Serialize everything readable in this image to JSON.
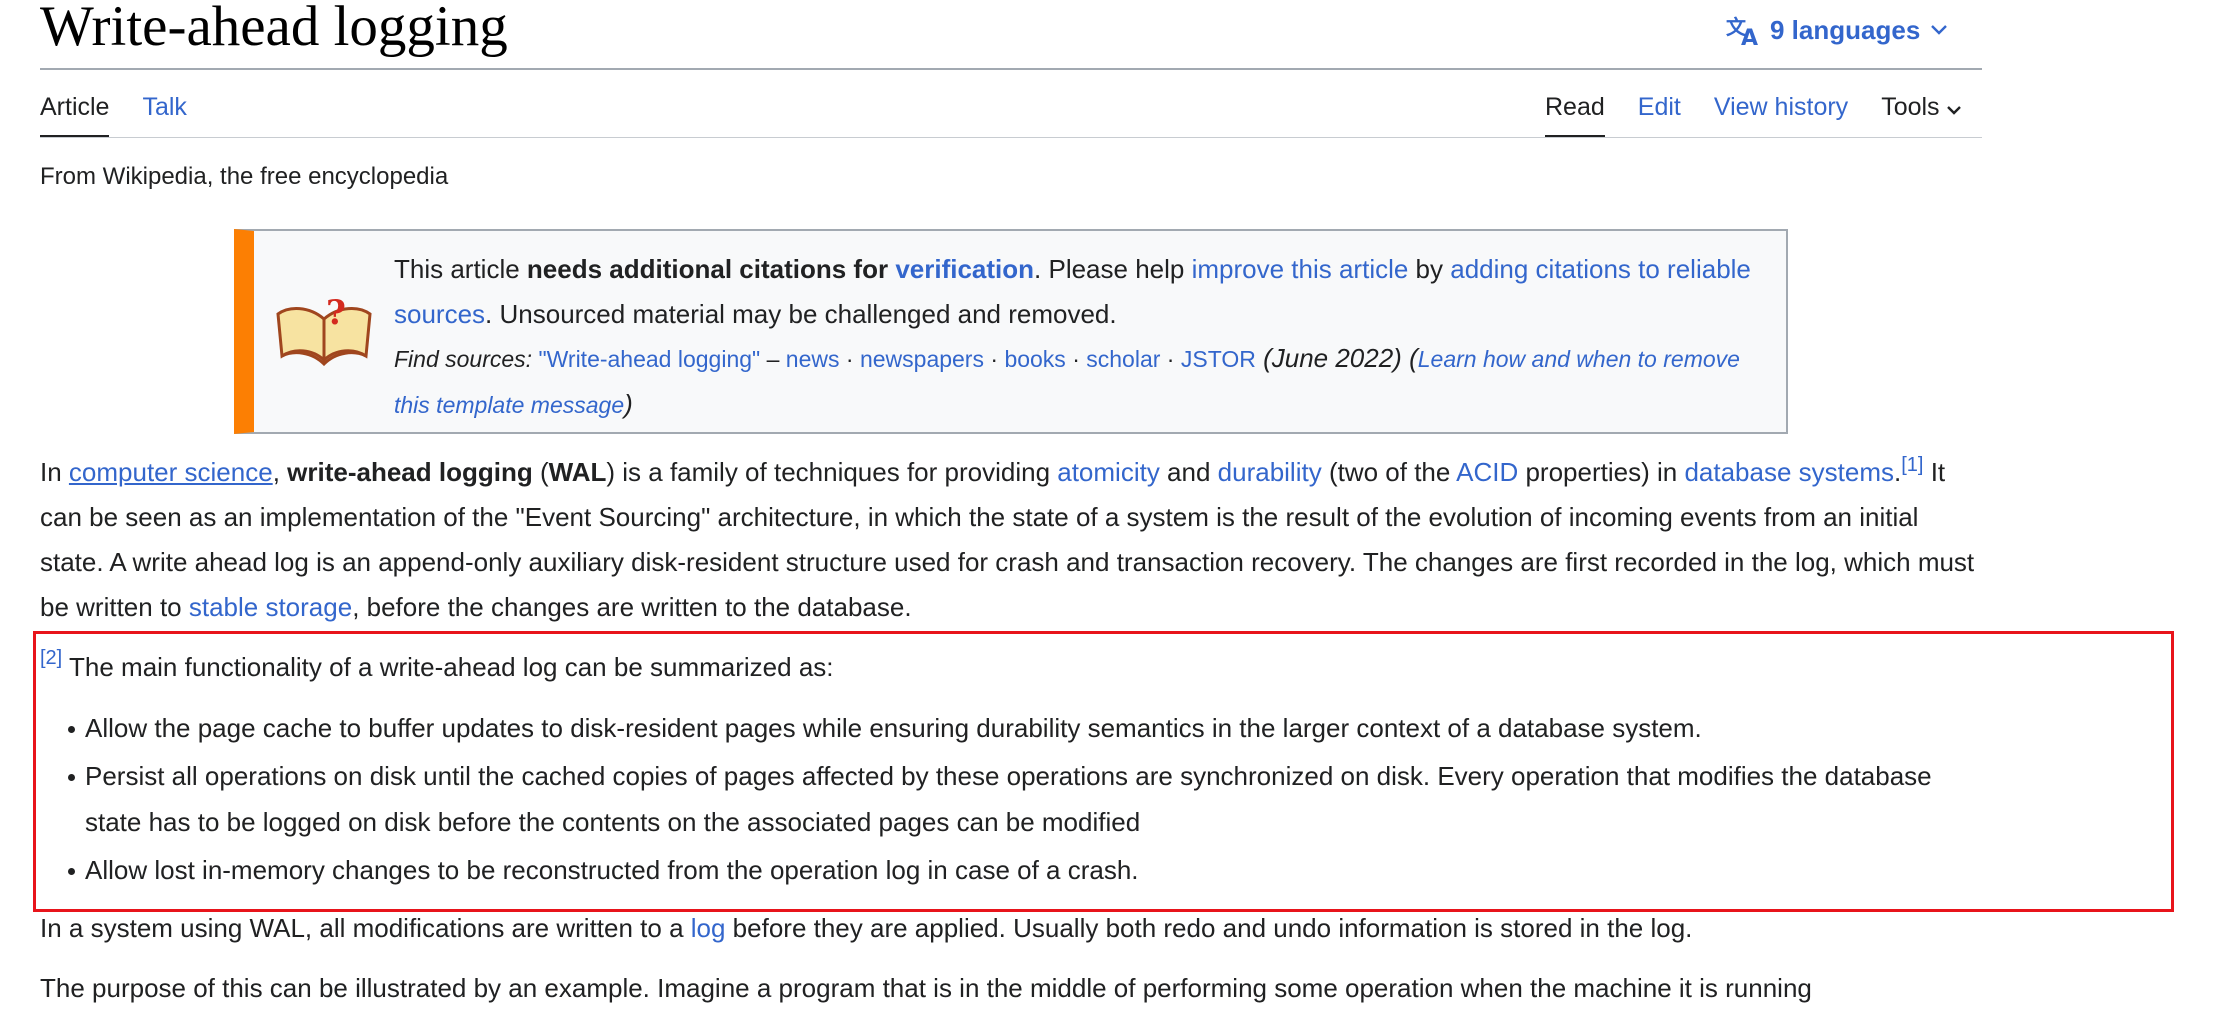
{
  "title": "Write-ahead logging",
  "languages": {
    "label": "9 languages"
  },
  "tabs_left": [
    {
      "label": "Article",
      "selected": true
    },
    {
      "label": "Talk",
      "selected": false
    }
  ],
  "tabs_right": [
    {
      "label": "Read",
      "selected": true
    },
    {
      "label": "Edit",
      "selected": false
    },
    {
      "label": "View history",
      "selected": false
    },
    {
      "label": "Tools",
      "selected": false
    }
  ],
  "tagline": "From Wikipedia, the free encyclopedia",
  "ambox": {
    "t1": "This article ",
    "bold": "needs additional citations for ",
    "verification": "verification",
    "t2": ". Please help ",
    "improve": "improve this article",
    "t3": " by ",
    "adding": "adding citations to reliable sources",
    "t4": ". Unsourced material may be challenged and removed.",
    "find_label": "Find sources: ",
    "find_query": "\"Write-ahead logging\"",
    "dash": " – ",
    "sources": [
      "news",
      "newspapers",
      "books",
      "scholar",
      "JSTOR"
    ],
    "sep": " · ",
    "date": " (June 2022)",
    "open_paren": " (",
    "learn": "Learn how and when to remove this template message",
    "close_paren": ")"
  },
  "intro": {
    "t1": "In ",
    "link_cs": "computer science",
    "t2": ", ",
    "bold_wal": "write-ahead logging",
    "t3": " (",
    "bold_abbr": "WAL",
    "t4": ") is a family of techniques for providing ",
    "link_atomicity": "atomicity",
    "t5": " and ",
    "link_durability": "durability",
    "t6": " (two of the ",
    "link_acid": "ACID",
    "t7": " properties) in ",
    "link_dbs": "database systems",
    "t8": ".",
    "ref1": "[1]",
    "t9": " It can be seen as an implementation of the \"Event Sourcing\" architecture, in which the state of a system is the result of the evolution of incoming events from an initial state. A write ahead log is an append-only auxiliary disk-resident structure used for crash and transaction recovery. The changes are first recorded in the log, which must be written to ",
    "link_stable": "stable storage",
    "t10": ", before the changes are written to the database."
  },
  "functionality": {
    "ref2": "[2]",
    "intro": " The main functionality of a write-ahead log can be summarized as:",
    "bullets": [
      "Allow the page cache to buffer updates to disk-resident pages while ensuring durability semantics in the larger context of a database system.",
      "Persist all operations on disk until the cached copies of pages affected by these operations are synchronized on disk. Every operation that modifies the database state has to be logged on disk before the contents on the associated pages can be modified",
      "Allow lost in-memory changes to be reconstructed from the operation log in case of a crash."
    ]
  },
  "wal_para": {
    "t1": "In a system using WAL, all modifications are written to a ",
    "link_log": "log",
    "t2": " before they are applied. Usually both redo and undo information is stored in the log."
  },
  "cut_para": "The purpose of this can be illustrated by an example. Imagine a program that is in the middle of performing some operation when the machine it is running",
  "colors": {
    "link": "#3366cc",
    "text": "#202122",
    "highlight_border": "#e8141b",
    "ambox_accent": "#fc7f03"
  }
}
